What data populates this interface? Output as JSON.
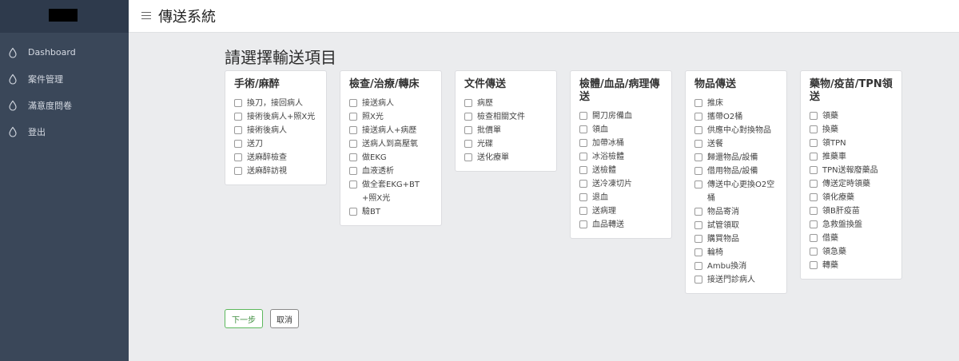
{
  "topbar": {
    "title": "傳送系統"
  },
  "sidebar": {
    "items": [
      {
        "label": "Dashboard",
        "icon": "droplet-icon"
      },
      {
        "label": "案件管理",
        "icon": "droplet-icon"
      },
      {
        "label": "滿意度問卷",
        "icon": "droplet-icon"
      },
      {
        "label": "登出",
        "icon": "droplet-icon"
      }
    ]
  },
  "main": {
    "heading": "請選擇輸送項目",
    "categories": [
      {
        "title": "手術/麻醉",
        "options": [
          "換刀，接回病人",
          "接術後病人+照X光",
          "接術後病人",
          "送刀",
          "送麻醉檢查",
          "送麻醉訪視"
        ]
      },
      {
        "title": "檢查/治療/轉床",
        "options": [
          "接送病人",
          "照X光",
          "接送病人+病歷",
          "送病人到高壓氧",
          "做EKG",
          "血液透析",
          "做全套EKG+BT+照X光",
          "驗BT"
        ]
      },
      {
        "title": "文件傳送",
        "options": [
          "病歷",
          "檢查相關文件",
          "批價單",
          "光碟",
          "送化療單"
        ]
      },
      {
        "title": "檢體/血品/病理傳送",
        "options": [
          "開刀房備血",
          "領血",
          "加帶冰桶",
          "冰浴檢體",
          "送檢體",
          "送冷凍切片",
          "退血",
          "送病理",
          "血品轉送"
        ]
      },
      {
        "title": "物品傳送",
        "options": [
          "推床",
          "攜帶O2桶",
          "供應中心對換物品",
          "送餐",
          "歸還物品/設備",
          "借用物品/設備",
          "傳送中心更換O2空桶",
          "物品寄消",
          "試管領取",
          "購買物品",
          "輪椅",
          "Ambu換消",
          "接送門診病人"
        ]
      },
      {
        "title": "藥物/疫苗/TPN領送",
        "options": [
          "領藥",
          "換藥",
          "領TPN",
          "推藥車",
          "TPN送報廢藥品",
          "傳送定時領藥",
          "領化療藥",
          "領B肝疫苗",
          "急救盤換盤",
          "借藥",
          "領急藥",
          "轉藥"
        ]
      }
    ],
    "buttons": {
      "next": "下一步",
      "cancel": "取消"
    }
  }
}
